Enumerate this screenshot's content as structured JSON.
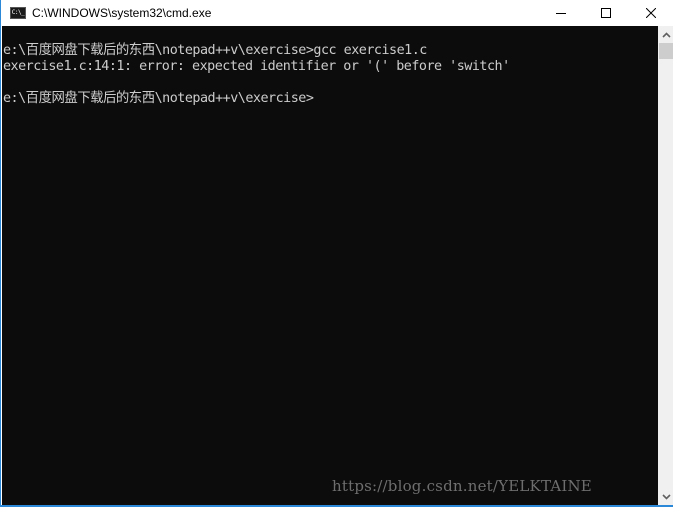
{
  "window": {
    "title": "C:\\WINDOWS\\system32\\cmd.exe",
    "icon": "console-icon",
    "icon_glyph": "C:\\_",
    "controls": {
      "minimize": "minimize-icon",
      "maximize": "maximize-icon",
      "close": "close-icon"
    }
  },
  "console": {
    "background": "#0c0c0c",
    "foreground": "#cccccc",
    "lines": [
      "e:\\百度网盘下载后的东西\\notepad++v\\exercise>gcc exercise1.c",
      "exercise1.c:14:1: error: expected identifier or '(' before 'switch'",
      "",
      "e:\\百度网盘下载后的东西\\notepad++v\\exercise>"
    ]
  },
  "watermark": "https://blog.csdn.net/YELKTAINE",
  "scrollbar": {
    "up_icon": "chevron-up-icon",
    "down_icon": "chevron-down-icon",
    "position_fraction": 0.0
  },
  "colors": {
    "border_accent": "#2b88d8",
    "scrollbar_track": "#f0f0f0",
    "scrollbar_thumb": "#cdcdcd"
  }
}
